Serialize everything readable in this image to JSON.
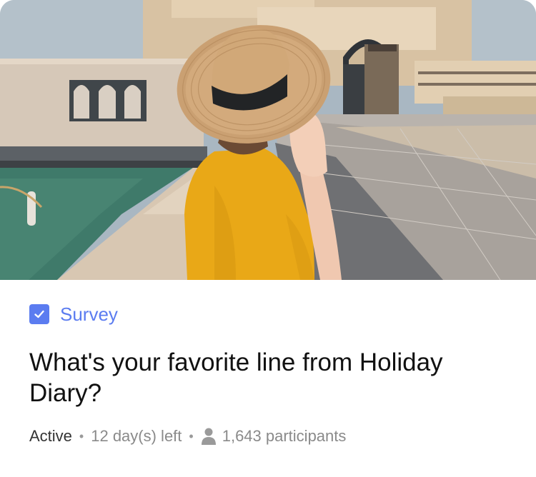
{
  "card": {
    "type_icon": "checkbox-checked-icon",
    "type_label": "Survey",
    "title": "What's your favorite line from Holiday Diary?",
    "status": "Active",
    "time_left": "12 day(s) left",
    "participants_icon": "person-icon",
    "participants": "1,643 participants",
    "colors": {
      "accent": "#5b7cf0",
      "title": "#111111",
      "muted": "#8a8a8a"
    }
  }
}
